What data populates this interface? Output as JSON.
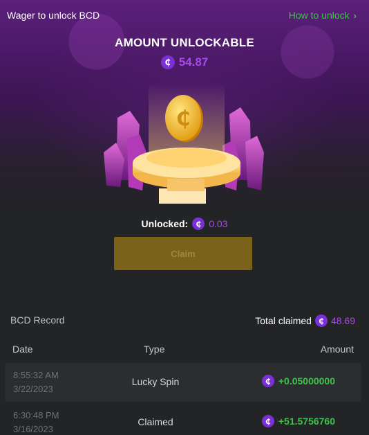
{
  "header": {
    "title": "Wager to unlock BCD",
    "how_link": "How to unlock"
  },
  "amount": {
    "label": "AMOUNT UNLOCKABLE",
    "value": "54.87",
    "currency_icon": "bcd-coin-icon"
  },
  "unlocked": {
    "label": "Unlocked:",
    "value": "0.03"
  },
  "claim": {
    "label": "Claim"
  },
  "record": {
    "title": "BCD Record",
    "total_label": "Total claimed",
    "total_value": "48.69"
  },
  "table": {
    "columns": [
      "Date",
      "Type",
      "Amount"
    ],
    "rows": [
      {
        "time": "8:55:32 AM",
        "date": "3/22/2023",
        "type": "Lucky Spin",
        "amount": "+0.05000000"
      },
      {
        "time": "6:30:48 PM",
        "date": "3/16/2023",
        "type": "Claimed",
        "amount": "+51.5756760"
      }
    ]
  },
  "colors": {
    "accent_purple": "#a64be8",
    "green": "#3ec24a",
    "claim_bg": "#7a6219"
  }
}
